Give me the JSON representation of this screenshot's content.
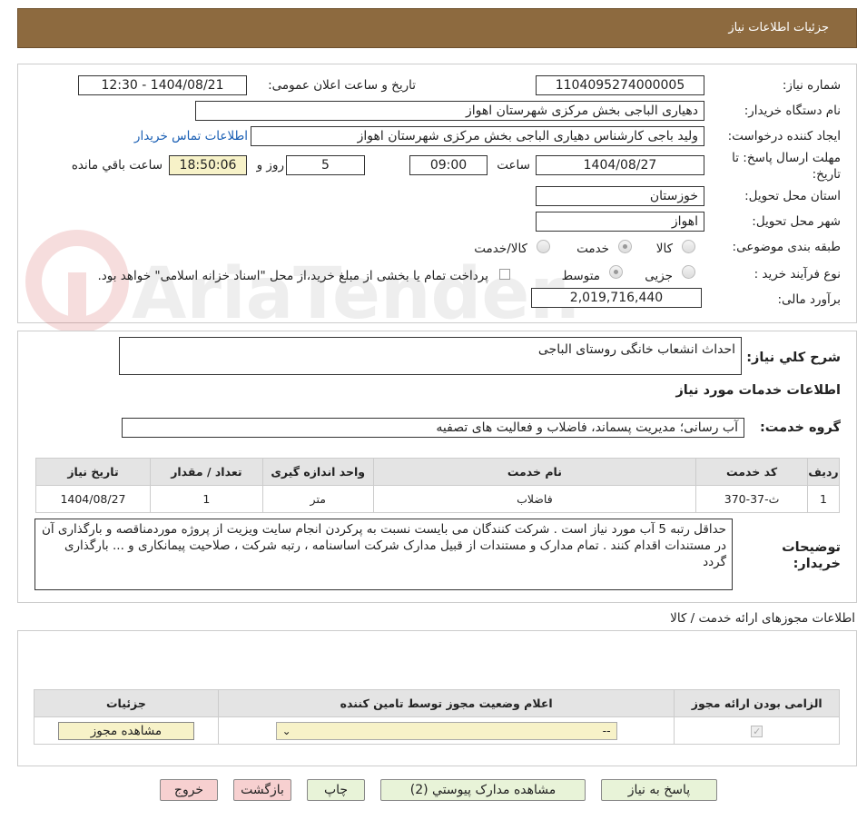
{
  "header": {
    "title": "جزئیات اطلاعات نیاز"
  },
  "form": {
    "need_number_label": "شماره نیاز:",
    "need_number": "1104095274000005",
    "announce_label": "تاریخ و ساعت اعلان عمومی:",
    "announce_value": "1404/08/21 - 12:30",
    "buyer_org_label": "نام دستگاه خریدار:",
    "buyer_org": "دهیاری الباجی بخش مرکزی شهرستان اهواز",
    "requester_label": "ایجاد کننده درخواست:",
    "requester": "ولید باجی کارشناس دهیاری الباجی بخش مرکزی شهرستان اهواز",
    "contact_link": "اطلاعات تماس خریدار",
    "deadline_label": "مهلت ارسال پاسخ: تا تاریخ:",
    "deadline_date": "1404/08/27",
    "time_label": "ساعت",
    "deadline_time": "09:00",
    "days": "5",
    "days_label": "روز و",
    "remaining": "18:50:06",
    "remaining_label": "ساعت باقي مانده",
    "province_label": "استان محل تحویل:",
    "province": "خوزستان",
    "city_label": "شهر محل تحویل:",
    "city": "اهواز",
    "category_label": "طبقه بندی موضوعی:",
    "category_options": [
      "کالا",
      "خدمت",
      "کالا/خدمت"
    ],
    "category_selected": "خدمت",
    "process_label": "نوع فرآیند خرید :",
    "process_options": [
      "جزیی",
      "متوسط"
    ],
    "process_selected": "متوسط",
    "payment_note": "پرداخت تمام یا بخشی از مبلغ خرید،از محل \"اسناد خزانه اسلامی\" خواهد بود.",
    "budget_label": "برآورد مالی:",
    "budget": "2,019,716,440"
  },
  "desc": {
    "label": "شرح کلي نیاز:",
    "value": "احداث انشعاب خانگی روستای الباجی"
  },
  "services": {
    "title": "اطلاعات خدمات مورد نیاز",
    "group_label": "گروه خدمت:",
    "group": "آب رسانی؛ مدیریت پسماند، فاضلاب و فعالیت های تصفیه",
    "columns": [
      "ردیف",
      "کد خدمت",
      "نام خدمت",
      "واحد اندازه گیری",
      "تعداد / مقدار",
      "تاریخ نیاز"
    ],
    "rows": [
      [
        "1",
        "ث-37-370",
        "فاضلاب",
        "متر",
        "1",
        "1404/08/27"
      ]
    ]
  },
  "buyer_notes": {
    "label": "توضیحات خریدار:",
    "value": "حداقل رتبه 5 آب مورد نیاز است .  شرکت کنندگان می بایست نسبت به پرکردن انجام سایت ویزیت از پروژه موردمناقصه و بارگذاری آن در مستندات اقدام کنند . تمام مدارک و مستندات از قبیل مدارک شرکت اساسنامه  ، رتبه شرکت ، صلاحیت پیمانکاری و ... بارگذاری گردد"
  },
  "permits": {
    "title": "اطلاعات مجوزهای ارائه خدمت / کالا",
    "columns": [
      "الزامی بودن ارائه مجوز",
      "اعلام وضعیت مجوز توسط تامین کننده",
      "جزئیات"
    ],
    "select_value": "--",
    "view_button": "مشاهده مجوز"
  },
  "buttons": {
    "reply": "پاسخ به نیاز",
    "attachments": "مشاهده مدارک پیوستي (2)",
    "print": "چاپ",
    "back": "بازگشت",
    "exit": "خروج"
  },
  "watermark": "AriaTender.net"
}
